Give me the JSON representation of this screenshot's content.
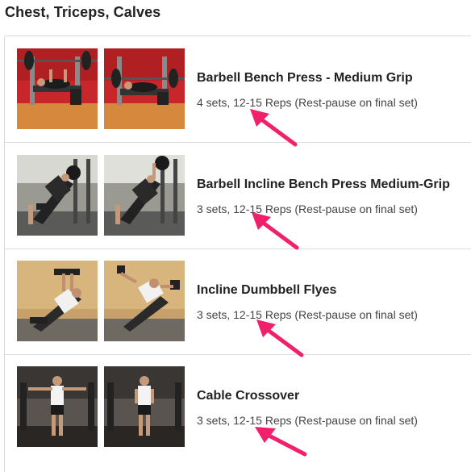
{
  "workout": {
    "title": "Chest, Triceps, Calves",
    "exercises": [
      {
        "name": "Barbell Bench Press - Medium Grip",
        "sets": "4 sets, 12-15 Reps (Rest-pause on final set)"
      },
      {
        "name": "Barbell Incline Bench Press Medium-Grip",
        "sets": "3 sets, 12-15 Reps (Rest-pause on final set)"
      },
      {
        "name": "Incline Dumbbell Flyes",
        "sets": "3 sets, 12-15 Reps (Rest-pause on final set)"
      },
      {
        "name": "Cable Crossover",
        "sets": "3 sets, 12-15 Reps (Rest-pause on final set)"
      }
    ]
  },
  "colors": {
    "annotation_arrow": "#f0206a",
    "text_dark": "#222222",
    "divider": "#dcdcdc"
  }
}
